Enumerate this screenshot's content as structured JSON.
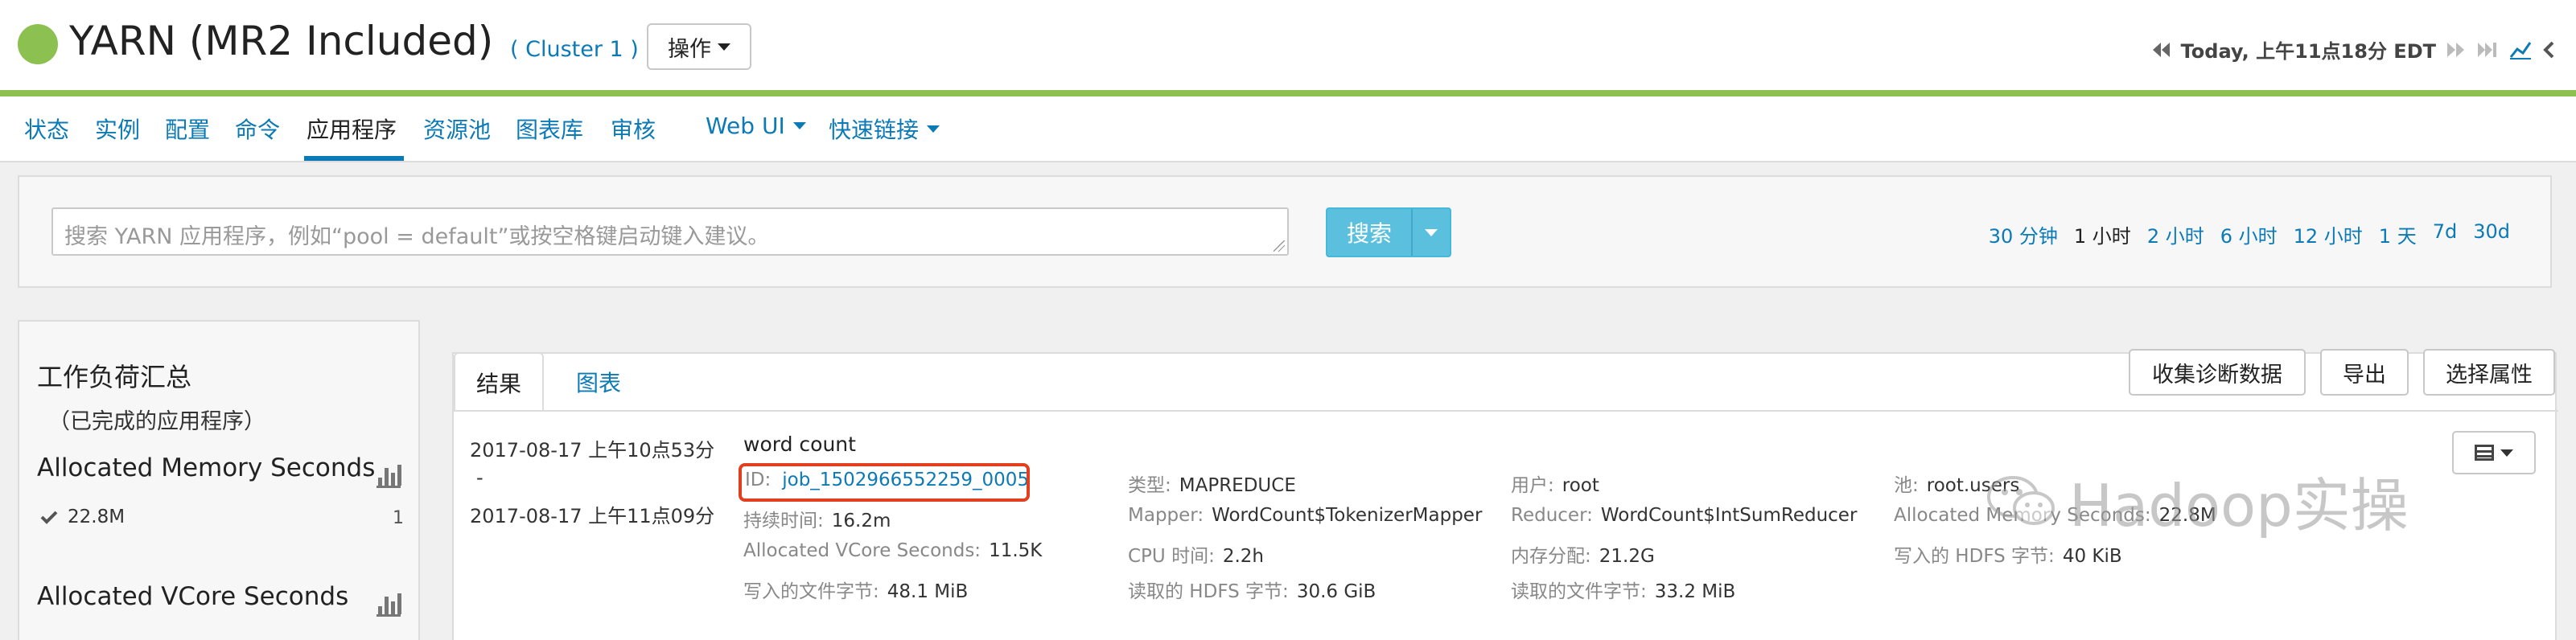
{
  "header": {
    "title": "YARN (MR2 Included)",
    "cluster": "( Cluster 1 )",
    "actions_label": "操作",
    "time_label": "Today, 上午11点18分 EDT"
  },
  "nav": {
    "items": [
      "状态",
      "实例",
      "配置",
      "命令",
      "应用程序",
      "资源池",
      "图表库",
      "审核",
      "Web UI",
      "快速链接"
    ],
    "active": "应用程序"
  },
  "search": {
    "placeholder": "搜索 YARN 应用程序，例如“pool = default”或按空格键启动键入建议。",
    "button_label": "搜索",
    "ranges": [
      "30 分钟",
      "1 小时",
      "2 小时",
      "6 小时",
      "12 小时",
      "1 天",
      "7d",
      "30d"
    ],
    "selected_range": "1 小时"
  },
  "summary": {
    "title": "工作负荷汇总",
    "subtitle": "（已完成的应用程序）",
    "metrics": [
      {
        "label": "Allocated Memory Seconds",
        "value": "22.8M",
        "count": "1"
      },
      {
        "label": "Allocated VCore Seconds"
      }
    ]
  },
  "results": {
    "tabs": [
      "结果",
      "图表"
    ],
    "buttons": {
      "diagnostics": "收集诊断数据",
      "export": "导出",
      "select_attributes": "选择属性"
    },
    "job": {
      "start_time": "2017-08-17 上午10点53分",
      "separator": "-",
      "end_time": "2017-08-17 上午11点09分",
      "name": "word count",
      "id_label": "ID:",
      "id_value": "job_1502966552259_0005",
      "duration_label": "持续时间:",
      "duration_value": "16.2m",
      "vcore_label": "Allocated VCore Seconds:",
      "vcore_value": "11.5K",
      "written_bytes_label": "写入的文件字节:",
      "written_bytes_value": "48.1 MiB",
      "type_label": "类型:",
      "type_value": "MAPREDUCE",
      "mapper_label": "Mapper:",
      "mapper_value": "WordCount$TokenizerMapper",
      "cpu_label": "CPU 时间:",
      "cpu_value": "2.2h",
      "hdfs_read_label": "读取的 HDFS 字节:",
      "hdfs_read_value": "30.6 GiB",
      "user_label": "用户:",
      "user_value": "root",
      "reducer_label": "Reducer:",
      "reducer_value": "WordCount$IntSumReducer",
      "memory_label": "内存分配:",
      "memory_value": "21.2G",
      "file_read_label": "读取的文件字节:",
      "file_read_value": "33.2 MiB",
      "pool_label": "池:",
      "pool_value": "root.users",
      "alloc_mem_label": "Allocated Memory Seconds:",
      "alloc_mem_value": "22.8M",
      "hdfs_written_label": "写入的 HDFS 字节:",
      "hdfs_written_value": "40 KiB"
    }
  },
  "watermark": {
    "text": "Hadoop实操"
  },
  "colors": {
    "status_green": "#8cc152",
    "link_blue": "#0b7ab6",
    "search_button": "#5bc0de",
    "highlight_red": "#e33e1e"
  }
}
